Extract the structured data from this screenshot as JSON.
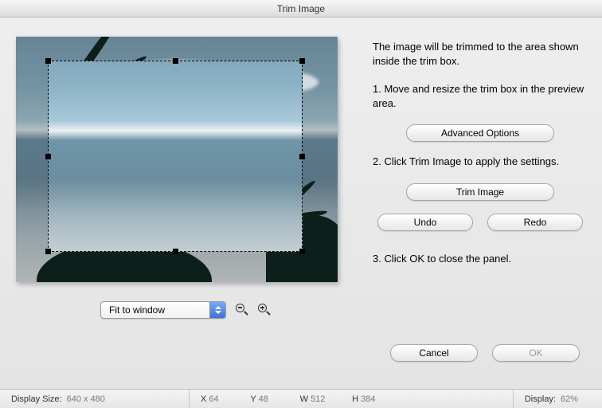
{
  "window": {
    "title": "Trim Image"
  },
  "instructions": {
    "intro": "The image will be trimmed to the area shown inside the trim box.",
    "step1": "1.  Move and resize the trim box in the preview area.",
    "step2": "2. Click Trim Image to apply the settings.",
    "step3": "3. Click OK to close the panel."
  },
  "buttons": {
    "advanced": "Advanced Options",
    "trim": "Trim Image",
    "undo": "Undo",
    "redo": "Redo",
    "cancel": "Cancel",
    "ok": "OK"
  },
  "zoom": {
    "mode": "Fit to window"
  },
  "status": {
    "display_size_label": "Display Size:",
    "display_size_value": "640 x 480",
    "x_label": "X",
    "x_value": "64",
    "y_label": "Y",
    "y_value": "48",
    "w_label": "W",
    "w_value": "512",
    "h_label": "H",
    "h_value": "384",
    "display_label": "Display:",
    "display_value": "62%"
  }
}
